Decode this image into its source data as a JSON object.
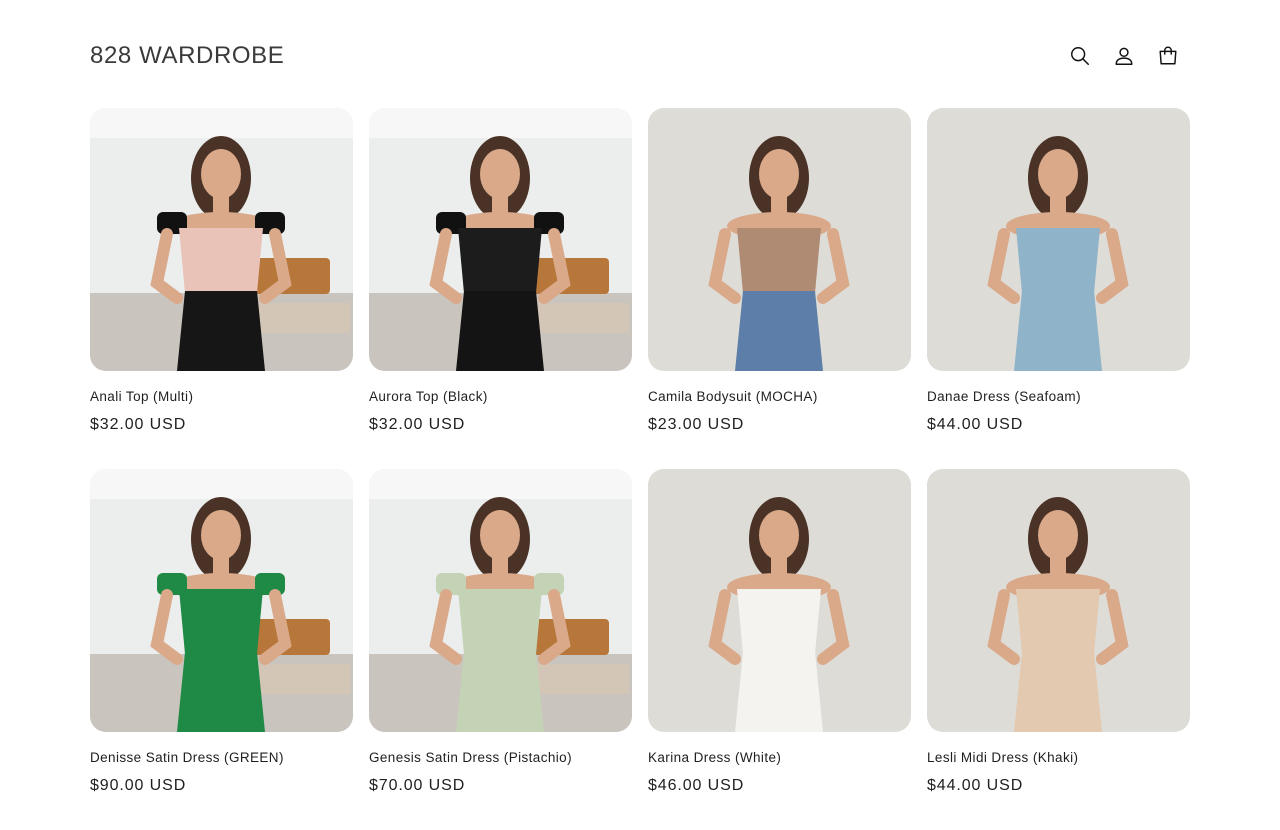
{
  "store": {
    "name": "828 WARDROBE"
  },
  "header": {
    "icons": [
      "search-icon",
      "account-icon",
      "cart-icon"
    ]
  },
  "products": [
    {
      "title": "Anali Top (Multi)",
      "price": "$32.00 USD",
      "scene": "studio",
      "top": "#e9c2b8",
      "bottom": "#161616",
      "sleeves": "#111111"
    },
    {
      "title": "Aurora Top (Black)",
      "price": "$32.00 USD",
      "scene": "studio",
      "top": "#1c1c1c",
      "bottom": "#141414",
      "sleeves": "#111111"
    },
    {
      "title": "Camila Bodysuit (MOCHA)",
      "price": "$23.00 USD",
      "scene": "wall",
      "top": "#b08b74",
      "bottom": "#5d7ea8",
      "sleeves": "none"
    },
    {
      "title": "Danae Dress (Seafoam)",
      "price": "$44.00 USD",
      "scene": "wall",
      "top": "#8fb3c9",
      "bottom": "#8fb3c9",
      "sleeves": "none"
    },
    {
      "title": "Denisse Satin Dress (GREEN)",
      "price": "$90.00 USD",
      "scene": "studio",
      "top": "#1f8a45",
      "bottom": "#1f8a45",
      "sleeves": "#1f8a45"
    },
    {
      "title": "Genesis Satin Dress (Pistachio)",
      "price": "$70.00 USD",
      "scene": "studio",
      "top": "#c4d3b6",
      "bottom": "#c4d3b6",
      "sleeves": "#c4d3b6"
    },
    {
      "title": "Karina Dress (White)",
      "price": "$46.00 USD",
      "scene": "wall",
      "top": "#f4f3f0",
      "bottom": "#f4f3f0",
      "sleeves": "none"
    },
    {
      "title": "Lesli Midi Dress (Khaki)",
      "price": "$44.00 USD",
      "scene": "wall",
      "top": "#e3c9b0",
      "bottom": "#e3c9b0",
      "sleeves": "none"
    }
  ]
}
